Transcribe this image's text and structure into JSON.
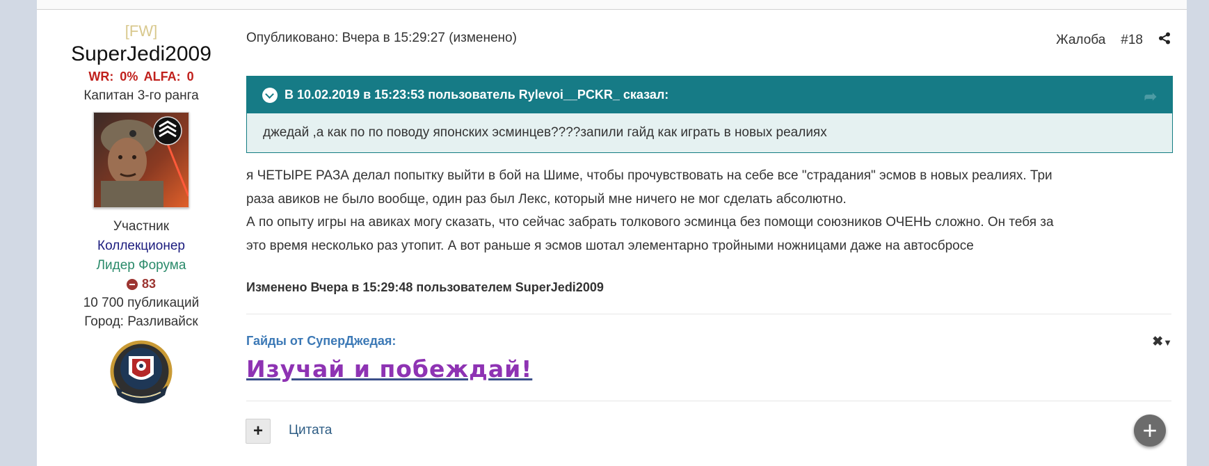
{
  "author": {
    "clan": "[FW]",
    "username": "SuperJedi2009",
    "stats": "WR: 0%  ALFA: 0",
    "rank": "Капитан 3-го ранга",
    "group": "Участник",
    "collector": "Коллекционер",
    "leader": "Лидер Форума",
    "reputation": "83",
    "posts": "10 700 публикаций",
    "city": "Город: Разливайск"
  },
  "post": {
    "published": "Опубликовано: Вчера в 15:29:27 (изменено)",
    "report": "Жалоба",
    "number": "#18",
    "quote_header": "В 10.02.2019 в 15:23:53 пользователь Rylevoi__PCKR_ сказал:",
    "quote_body": "джедай ,а как по по поводу японских эсминцев????запили гайд как играть в новых реалиях",
    "body_lines": [
      "я ЧЕТЫРЕ РАЗА  делал попытку выйти в бой на Шиме, чтобы прочувствовать на себе все \"страдания\" эсмов в новых реалиях. Три",
      "раза авиков не было вообще, один раз был Лекс, который мне ничего не мог сделать абсолютно.",
      "А по опыту игры на авиках могу сказать, что сейчас забрать толкового эсминца без помощи союзников ОЧЕНЬ сложно. Он тебя за",
      "это время несколько раз утопит. А вот раньше я эсмов шотал элементарно тройными ножницами даже на автосбросе"
    ],
    "edited": "Изменено Вчера в 15:29:48 пользователем SuperJedi2009"
  },
  "signature": {
    "title": "Гайды от СуперДжедая:",
    "link": "Изучай и побеждай!"
  },
  "footer": {
    "quote_label": "Цитата"
  },
  "colors": {
    "quote_header_bg": "#167b86",
    "quote_body_bg": "#e5f1f1",
    "winrate_red": "#c0201c",
    "signature_purple": "#8e33b3",
    "link_blue": "#3c79b6"
  },
  "icons": [
    "share-icon",
    "chevron-down-icon",
    "close-icon",
    "plus-icon"
  ]
}
